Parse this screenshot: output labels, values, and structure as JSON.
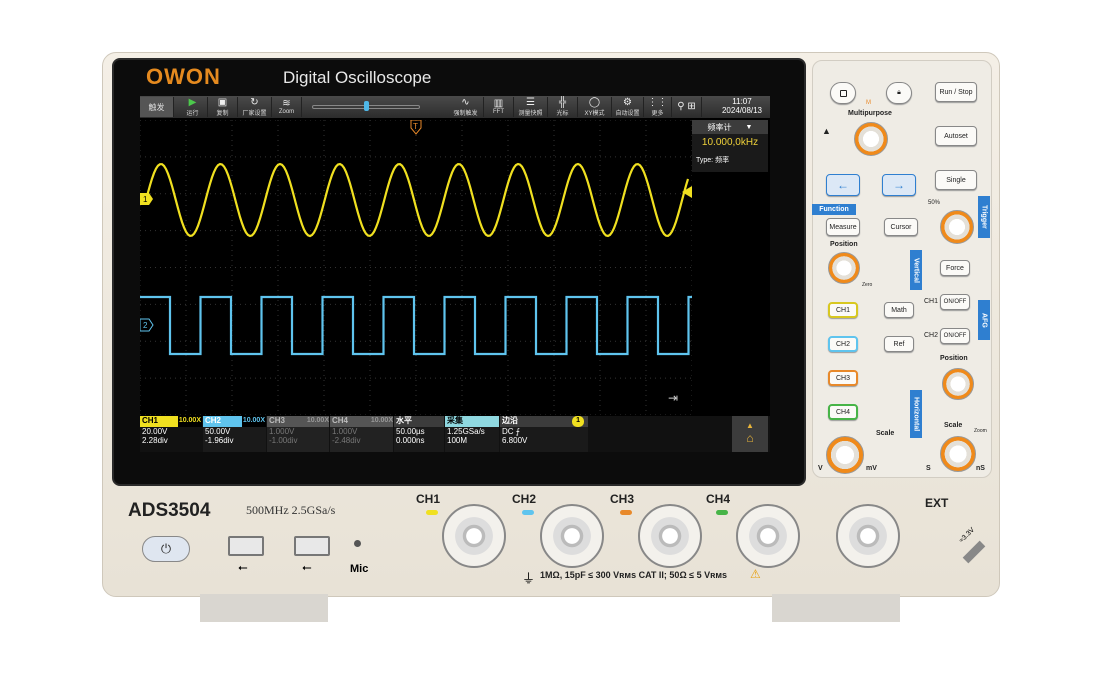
{
  "brand": "OWON",
  "title": "Digital Oscilloscope",
  "toolbar": {
    "trigger": "触发",
    "items": [
      {
        "icon": "▶",
        "label": "运行",
        "w": 30
      },
      {
        "icon": "▣",
        "label": "复制",
        "w": 30
      },
      {
        "icon": "↻",
        "label": "厂家设置",
        "w": 34
      },
      {
        "icon": "≋",
        "label": "Zoom",
        "w": 30
      },
      {
        "icon": "∿",
        "label": "强制触发",
        "w": 36
      },
      {
        "icon": "▥",
        "label": "FFT",
        "w": 30
      },
      {
        "icon": "☰",
        "label": "测量快照",
        "w": 34
      },
      {
        "icon": "╬",
        "label": "光标",
        "w": 30
      },
      {
        "icon": "◯",
        "label": "XY模式",
        "w": 34
      },
      {
        "icon": "⚙",
        "label": "自动设置",
        "w": 32
      },
      {
        "icon": "⋮⋮",
        "label": "更多",
        "w": 28
      },
      {
        "icon": "⚲ ⊞",
        "label": "",
        "w": 30
      }
    ]
  },
  "clock": {
    "time": "11:07",
    "date": "2024/08/13"
  },
  "measure_panel": {
    "title": "频率计",
    "value": "10.000,0kHz",
    "type": "Type: 频率"
  },
  "markers": {
    "ch1": "1",
    "ch2": "2",
    "trigger": "T"
  },
  "status": {
    "ch1": {
      "name": "CH1",
      "probe": "10.00X",
      "scale": "20.00V",
      "pos": "2.28div"
    },
    "ch2": {
      "name": "CH2",
      "probe": "10.00X",
      "scale": "50.00V",
      "pos": "-1.96div"
    },
    "ch3": {
      "name": "CH3",
      "probe": "10.00X",
      "scale": "1.000V",
      "pos": "-1.00div"
    },
    "ch4": {
      "name": "CH4",
      "probe": "10.00X",
      "scale": "1.000V",
      "pos": "-2.48div"
    },
    "horizontal": {
      "name": "水平",
      "scale": "50.00µs",
      "offset": "0.000ns"
    },
    "acquire": {
      "name": "采集",
      "rate": "1.25GSa/s",
      "depth": "100M"
    },
    "trigger": {
      "name": "边沿",
      "source": "1",
      "coupling": "DC ⨍",
      "level": "6.800V"
    }
  },
  "colors": {
    "ch1": "#f0e020",
    "ch2": "#5fc4ee",
    "ch3": "#e8892a",
    "ch4": "#47b447",
    "accent": "#2f7fd0",
    "knob": "#f08a1a"
  },
  "panel": {
    "run_stop": "Run / Stop",
    "autoset": "Autoset",
    "single": "Single",
    "multipurpose": "Multipurpose",
    "function": "Function",
    "measure": "Measure",
    "cursor": "Cursor",
    "trigger": "Trigger",
    "force": "Force",
    "position": "Position",
    "vertical": "Vertical",
    "math": "Math",
    "ref": "Ref",
    "ch1": "CH1",
    "ch2": "CH2",
    "ch3": "CH3",
    "ch4": "CH4",
    "onoff": "ON/OFF",
    "afg": "AFG",
    "horizontal": "Horizontal",
    "scale": "Scale",
    "v": "V",
    "mv": "mV",
    "s": "S",
    "ns": "nS",
    "zero": "Zero",
    "fifty": "50%",
    "zoom": "Zoom",
    "m": "M"
  },
  "front": {
    "model": "ADS3504",
    "spec": "500MHz  2.5GSa/s",
    "mic": "Mic",
    "ext": "EXT",
    "ch_labels": [
      "CH1",
      "CH2",
      "CH3",
      "CH4"
    ],
    "rating": "1MΩ, 15pF ≤ 300 Vʀᴍs CAT II; 50Ω ≤ 5 Vʀᴍs",
    "probe_comp": "≈3.3V"
  }
}
